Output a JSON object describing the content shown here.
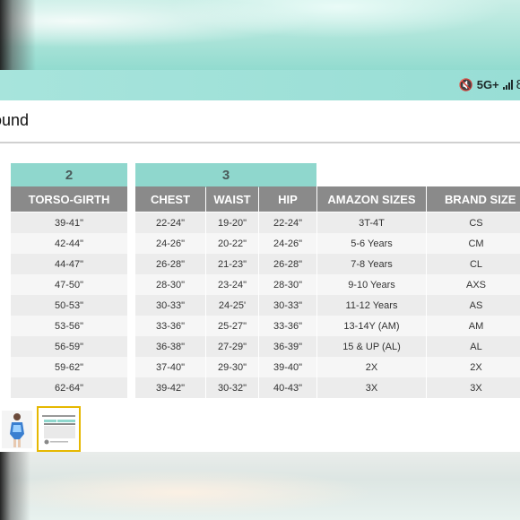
{
  "status_bar": {
    "network": "5G+",
    "battery_partial": "8",
    "mute_icon": "vibrate-mute-icon",
    "signal_icon": "signal-bars-icon"
  },
  "search": {
    "text": "ound"
  },
  "panel_left": {
    "label": "2",
    "header": "TORSO-GIRTH",
    "rows": [
      "39-41\"",
      "42-44\"",
      "44-47\"",
      "47-50\"",
      "50-53\"",
      "53-56\"",
      "56-59\"",
      "59-62\"",
      "62-64\""
    ]
  },
  "panel_right": {
    "label": "3",
    "headers": [
      "CHEST",
      "WAIST",
      "HIP",
      "AMAZON SIZES",
      "BRAND SIZE"
    ],
    "rows": [
      [
        "22-24\"",
        "19-20\"",
        "22-24\"",
        "3T-4T",
        "CS"
      ],
      [
        "24-26\"",
        "20-22\"",
        "24-26\"",
        "5-6 Years",
        "CM"
      ],
      [
        "26-28\"",
        "21-23\"",
        "26-28\"",
        "7-8 Years",
        "CL"
      ],
      [
        "28-30\"",
        "23-24\"",
        "28-30\"",
        "9-10 Years",
        "AXS"
      ],
      [
        "30-33\"",
        "24-25'",
        "30-33\"",
        "11-12 Years",
        "AS"
      ],
      [
        "33-36\"",
        "25-27\"",
        "33-36\"",
        "13-14Y (AM)",
        "AM"
      ],
      [
        "36-38\"",
        "27-29\"",
        "36-39\"",
        "15 & UP (AL)",
        "AL"
      ],
      [
        "37-40\"",
        "29-30\"",
        "39-40\"",
        "2X",
        "2X"
      ],
      [
        "39-42\"",
        "30-32\"",
        "40-43\"",
        "3X",
        "3X"
      ]
    ]
  },
  "colors": {
    "teal_label": "#8fd7cd",
    "header_gray": "#8a8a8a",
    "row_odd": "#ececec",
    "row_even": "#f6f6f6",
    "thumb_selected": "#e6b800"
  }
}
